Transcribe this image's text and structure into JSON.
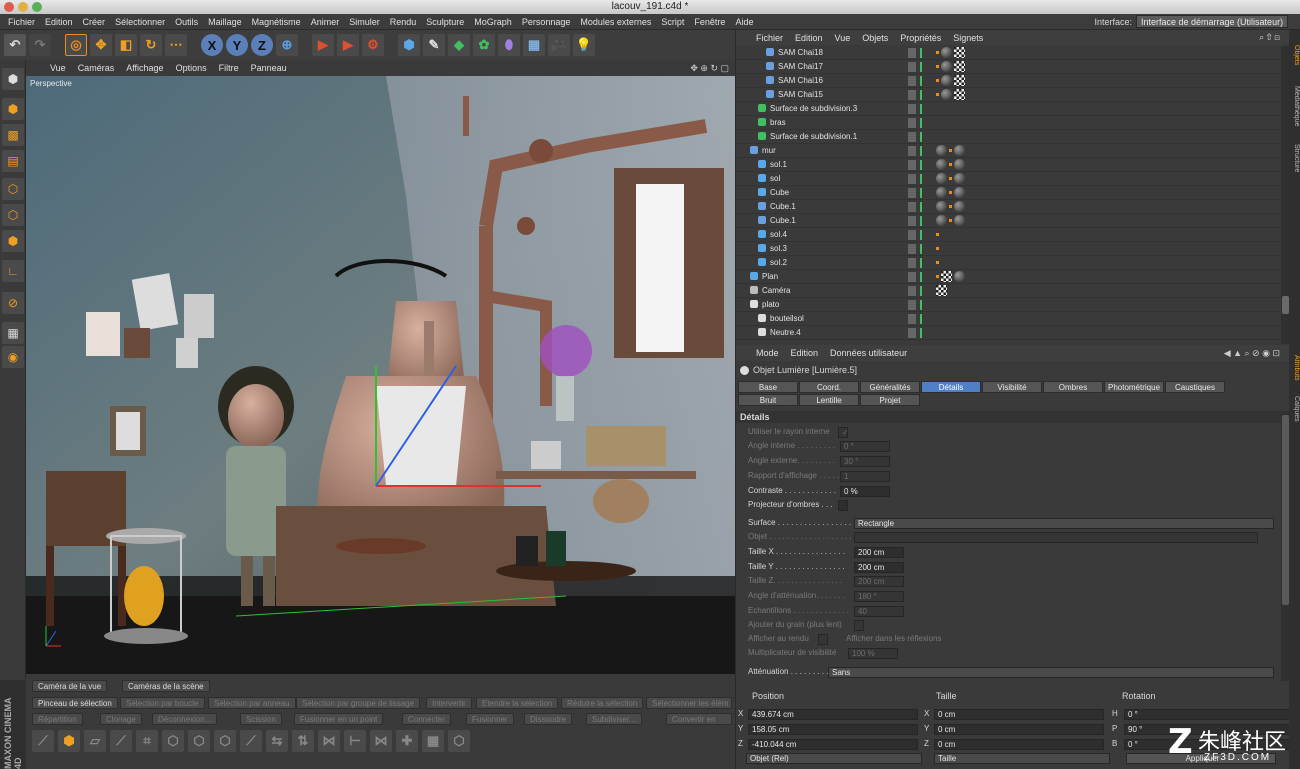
{
  "window": {
    "title": "lacouv_191.c4d *"
  },
  "menubar": {
    "items": [
      "Fichier",
      "Edition",
      "Créer",
      "Sélectionner",
      "Outils",
      "Maillage",
      "Magnétisme",
      "Animer",
      "Simuler",
      "Rendu",
      "Sculpture",
      "MoGraph",
      "Personnage",
      "Modules externes",
      "Script",
      "Fenêtre",
      "Aide"
    ],
    "interface_label": "Interface:",
    "interface_value": "Interface de démarrage (Utilisateur)"
  },
  "toolbar": {
    "axis_x": "X",
    "axis_y": "Y",
    "axis_z": "Z"
  },
  "viewport": {
    "menu": [
      "Vue",
      "Caméras",
      "Affichage",
      "Options",
      "Filtre",
      "Panneau"
    ],
    "label": "Perspective"
  },
  "bottom": {
    "row1": [
      "Caméra de la vue",
      "Caméras de la scène"
    ],
    "row2": [
      "Pinceau de sélection",
      "Sélection par boucle",
      "Sélection par anneau",
      "Sélection par groupe de lissage",
      "Intervertir",
      "Etendre la sélection",
      "Réduire la sélection",
      "Sélectionner les élém"
    ],
    "row3": [
      "Répartition",
      "Clonage",
      "Déconnexion...",
      "Scission",
      "Fusionner en un point",
      "Connecter",
      "Fusionner",
      "Dissoudre",
      "Subdiviser...",
      "Convertir en"
    ],
    "brand": "MAXON CINEMA 4D"
  },
  "objects": {
    "menu": [
      "Fichier",
      "Edition",
      "Vue",
      "Objets",
      "Propriétés",
      "Signets"
    ],
    "rows": [
      {
        "name": "SAM Chai18",
        "indent": 2,
        "type": "bone"
      },
      {
        "name": "SAM Chai17",
        "indent": 2,
        "type": "bone"
      },
      {
        "name": "SAM Chai16",
        "indent": 2,
        "type": "bone"
      },
      {
        "name": "SAM Chai15",
        "indent": 2,
        "type": "bone"
      },
      {
        "name": "Surface de subdivision.3",
        "indent": 1,
        "type": "green"
      },
      {
        "name": "bras",
        "indent": 1,
        "type": "green"
      },
      {
        "name": "Surface de subdivision.1",
        "indent": 1,
        "type": "green"
      },
      {
        "name": "mur",
        "indent": 0,
        "type": "bone"
      },
      {
        "name": "sol.1",
        "indent": 1,
        "type": "blue"
      },
      {
        "name": "sol",
        "indent": 1,
        "type": "blue"
      },
      {
        "name": "Cube",
        "indent": 1,
        "type": "blue"
      },
      {
        "name": "Cube.1",
        "indent": 1,
        "type": "bone"
      },
      {
        "name": "Cube.1",
        "indent": 1,
        "type": "bone"
      },
      {
        "name": "sol.4",
        "indent": 1,
        "type": "blue"
      },
      {
        "name": "sol.3",
        "indent": 1,
        "type": "blue"
      },
      {
        "name": "sol.2",
        "indent": 1,
        "type": "blue"
      },
      {
        "name": "Plan",
        "indent": 0,
        "type": "blue"
      },
      {
        "name": "Caméra",
        "indent": 0,
        "type": "camera"
      },
      {
        "name": "plato",
        "indent": 0,
        "type": "null"
      },
      {
        "name": "bouteilsol",
        "indent": 1,
        "type": "null"
      },
      {
        "name": "Neutre.4",
        "indent": 1,
        "type": "null"
      }
    ]
  },
  "attributes": {
    "menu": [
      "Mode",
      "Edition",
      "Données utilisateur"
    ],
    "object_title": "Objet Lumière [Lumière.5]",
    "tabs_row1": [
      "Base",
      "Coord.",
      "Généralités",
      "Détails",
      "Visibilité",
      "Ombres",
      "Photométrique",
      "Caustiques"
    ],
    "tabs_row2": [
      "Bruit",
      "Lentille",
      "Projet"
    ],
    "active_tab": "Détails",
    "section": "Détails",
    "props": [
      {
        "label": "Utiliser le rayon interne",
        "value": "✓",
        "dim": true,
        "kind": "check"
      },
      {
        "label": "Angle interne . . . . . . . . .",
        "value": "0 °",
        "dim": true
      },
      {
        "label": "Angle externe. . . . . . . . .",
        "value": "30 °",
        "dim": true
      },
      {
        "label": "Rapport d'affichage . . . . .",
        "value": "1",
        "dim": true
      },
      {
        "label": "Contraste . . . . . . . . . . . .",
        "value": "0 %",
        "dim": false
      },
      {
        "label": "Projecteur d'ombres . . .",
        "value": "",
        "dim": false,
        "kind": "check"
      },
      {
        "label": "Surface . . . . . . . . . . . . . . . . . . .",
        "value": "Rectangle",
        "dim": false,
        "kind": "dropdown"
      },
      {
        "label": "Objet . . . . . . . . . . . . . . . . . . . .",
        "value": "",
        "dim": true,
        "kind": "link"
      },
      {
        "label": "Taille X . . . . . . . . . . . . . . . .",
        "value": "200 cm",
        "dim": false
      },
      {
        "label": "Taille Y . . . . . . . . . . . . . . . .",
        "value": "200 cm",
        "dim": false
      },
      {
        "label": "Taille Z. . . . . . . . . . . . . . . .",
        "value": "200 cm",
        "dim": true
      },
      {
        "label": "Angle d'atténuation. . . . . . .",
        "value": "180 °",
        "dim": true
      },
      {
        "label": "Echantillons . . . . . . . . . . . . .",
        "value": "40",
        "dim": true
      },
      {
        "label": "Ajouter du grain (plus lent)",
        "value": "",
        "dim": true,
        "kind": "check"
      },
      {
        "label": "Afficher au rendu",
        "value": "",
        "dim": true,
        "kind": "check"
      },
      {
        "label": "Multiplicateur de visibilité",
        "value": "100 %",
        "dim": true
      },
      {
        "label": "Atténuation . . . . . . . . . . . . . .",
        "value": "Sans",
        "dim": false,
        "kind": "dropdown"
      }
    ],
    "extra_label": "Afficher dans les réflexions"
  },
  "coords": {
    "headers": [
      "Position",
      "Taille",
      "Rotation"
    ],
    "rows": [
      {
        "axis": "X",
        "pos": "439.674 cm",
        "size_axis": "X",
        "size": "0 cm",
        "rot_axis": "H",
        "rot": "0 °"
      },
      {
        "axis": "Y",
        "pos": "158.05 cm",
        "size_axis": "Y",
        "size": "0 cm",
        "rot_axis": "P",
        "rot": "90 °"
      },
      {
        "axis": "Z",
        "pos": "-410.044 cm",
        "size_axis": "Z",
        "size": "0 cm",
        "rot_axis": "B",
        "rot": "0 °"
      }
    ],
    "mode1": "Objet (Rel)",
    "mode2": "Taille",
    "apply": "Appliquer"
  },
  "right_strip": {
    "tabs": [
      "Objets",
      "Médiathèque",
      "Structure",
      "Attributs",
      "Calques"
    ]
  },
  "watermark": {
    "text": "朱峰社区",
    "sub": "ZF3D.COM"
  },
  "colors": {
    "accent": "#4f7fc7",
    "orange": "#f08a1c"
  }
}
